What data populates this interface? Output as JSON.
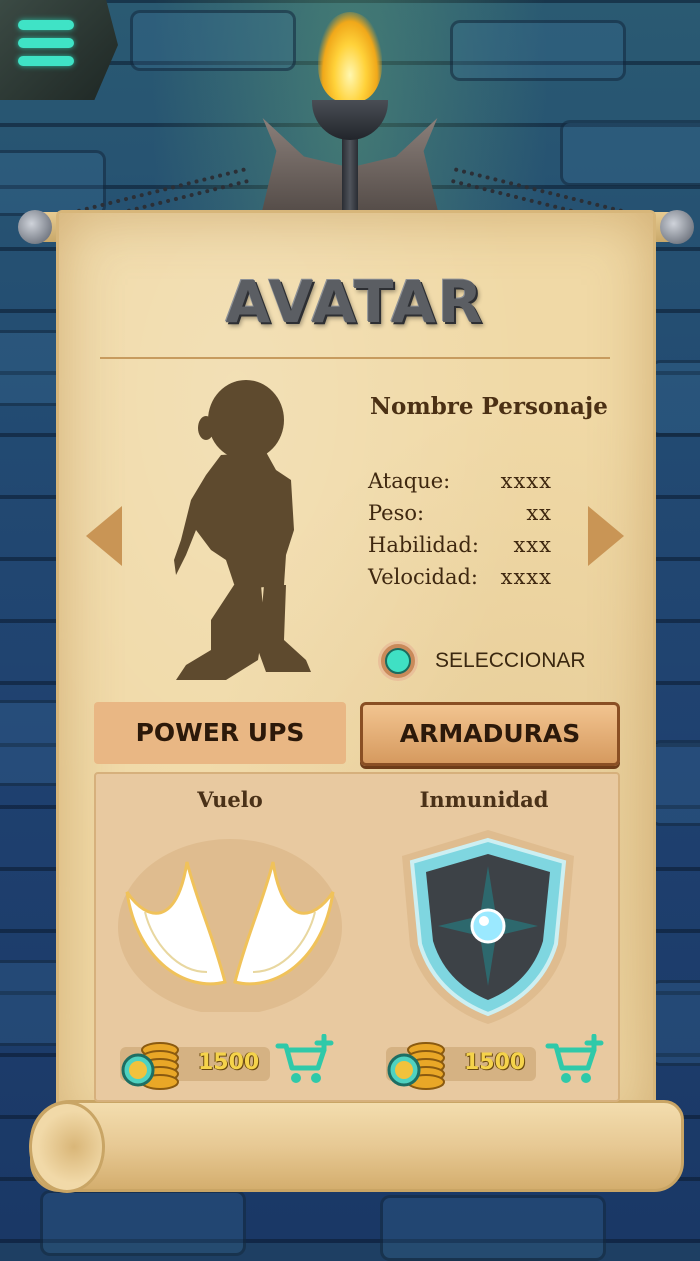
{
  "screen": {
    "title": "AVATAR",
    "character": {
      "name": "Nombre Personaje",
      "stats": [
        {
          "label": "Ataque:",
          "value": "xxxx"
        },
        {
          "label": "Peso:",
          "value": "xx"
        },
        {
          "label": "Habilidad:",
          "value": "xxx"
        },
        {
          "label": "Velocidad:",
          "value": "xxxx"
        }
      ],
      "select_label": "SELECCIONAR"
    },
    "tabs": [
      {
        "label": "POWER UPS"
      },
      {
        "label": "ARMADURAS"
      }
    ],
    "items": [
      {
        "name": "Vuelo",
        "price": "1500",
        "icon": "wings-icon"
      },
      {
        "name": "Inmunidad",
        "price": "1500",
        "icon": "shield-icon"
      }
    ]
  },
  "colors": {
    "accent": "#3fe0c4",
    "parchment": "#f0d9a6",
    "arrow": "#c99555",
    "text_dark": "#4b3014",
    "coin_gold": "#f5d34b"
  }
}
